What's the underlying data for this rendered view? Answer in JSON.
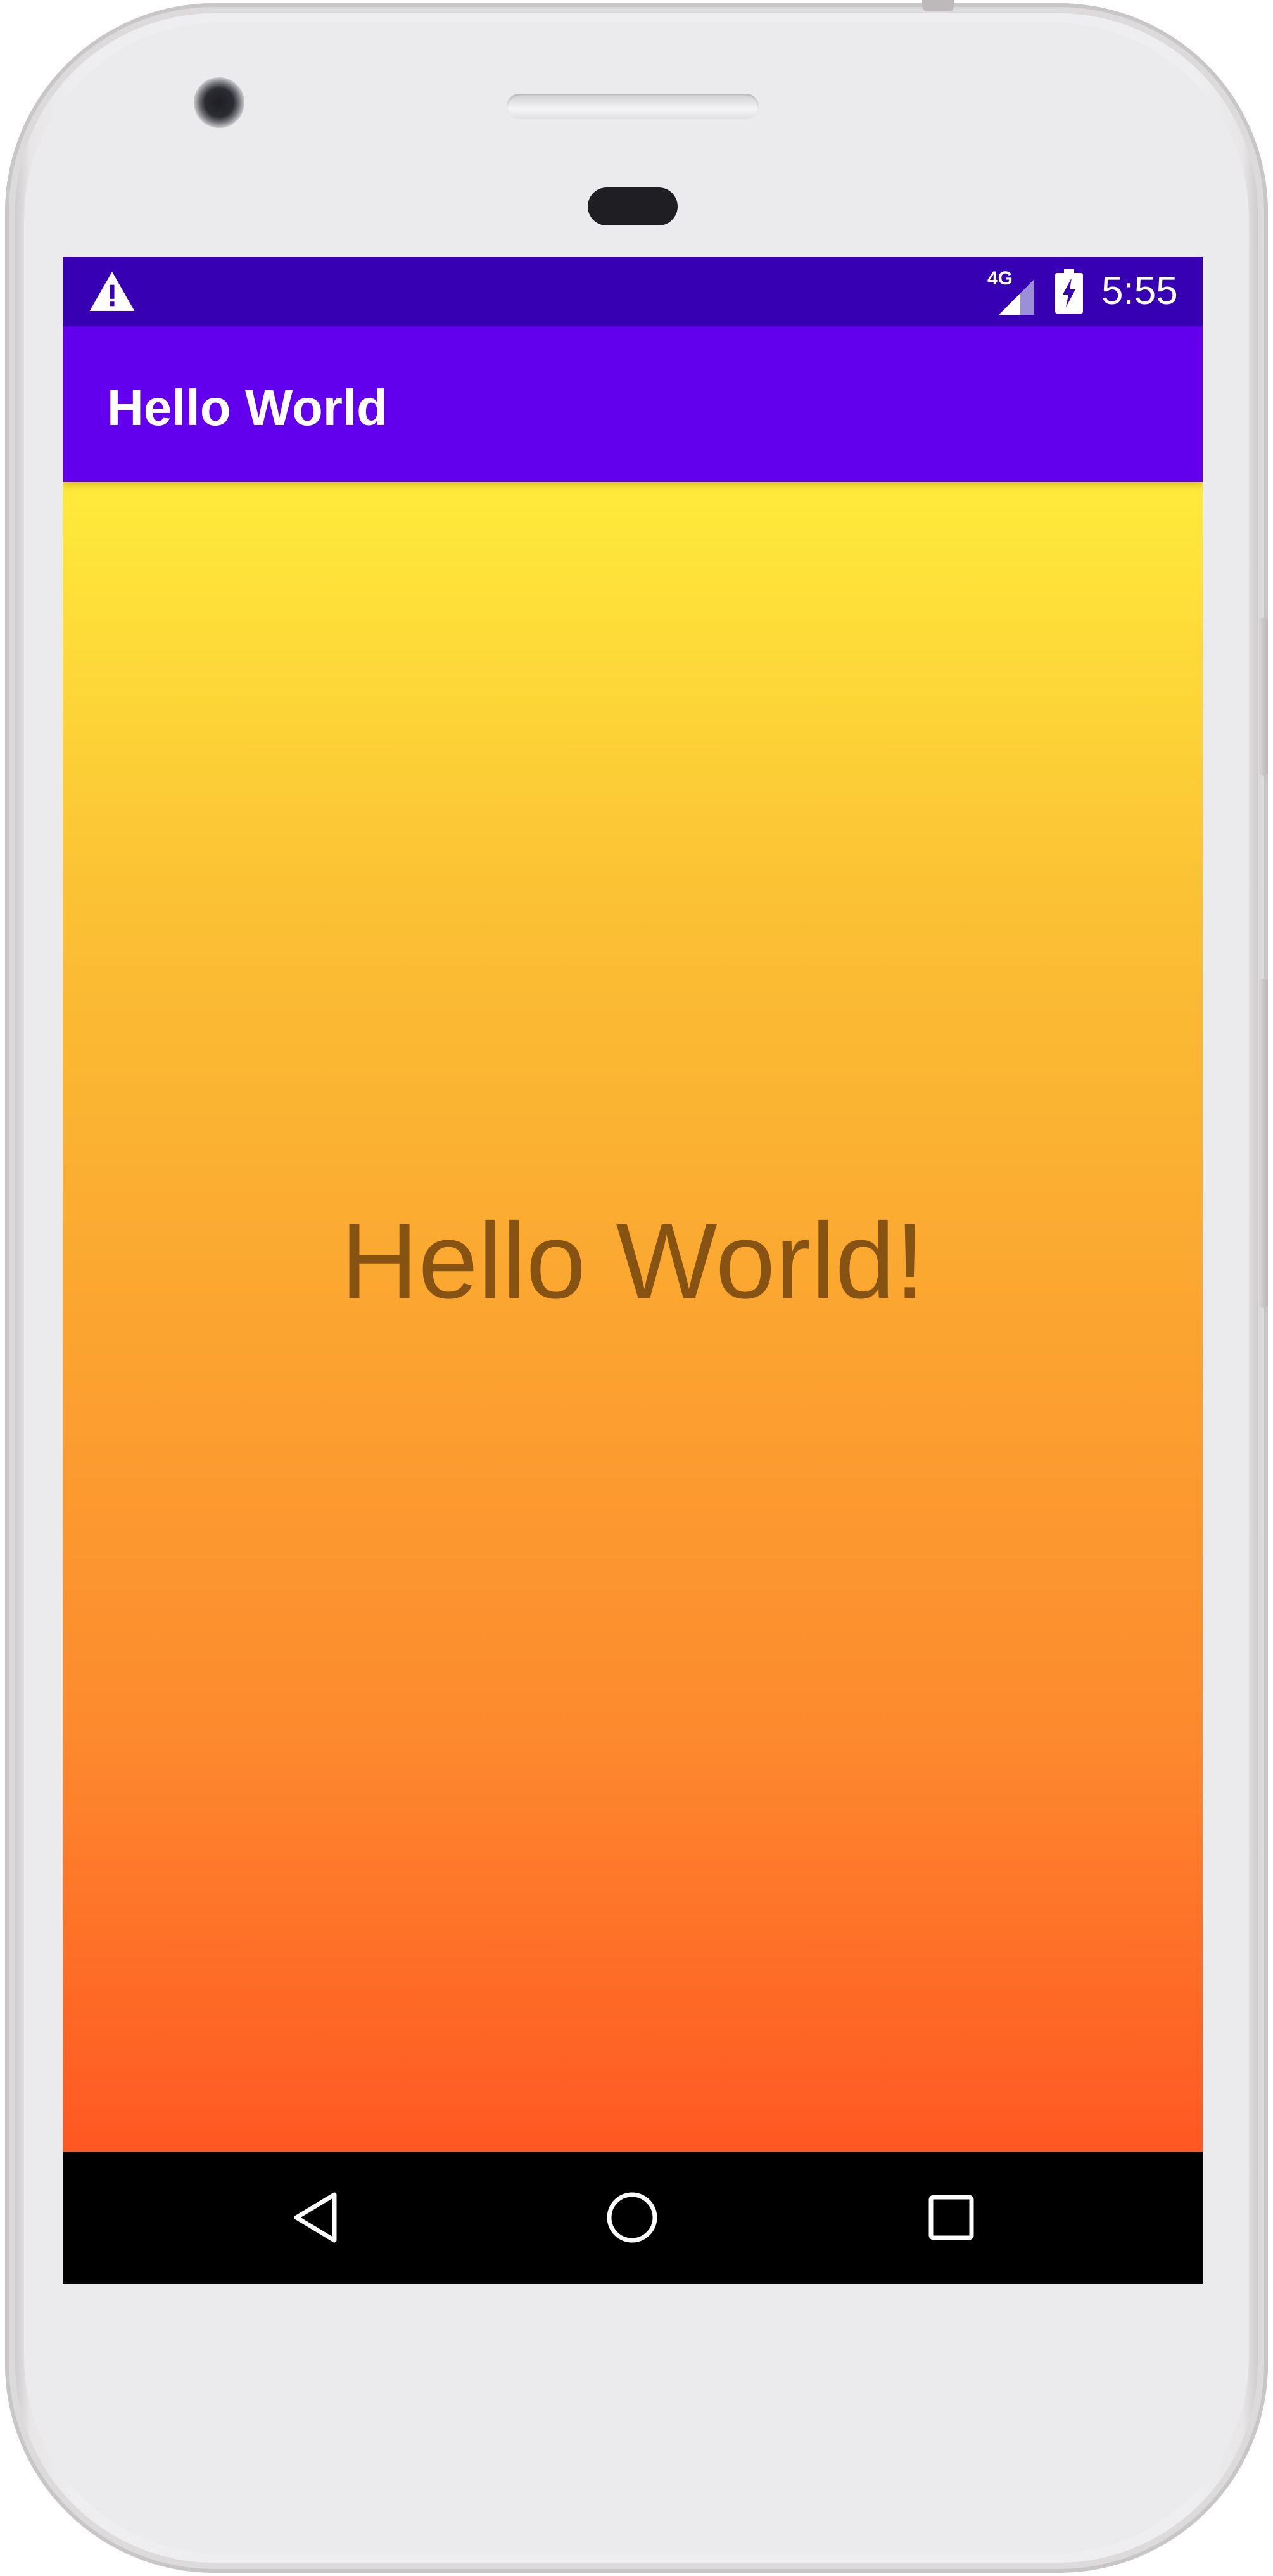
{
  "status_bar": {
    "time": "5:55",
    "network": "4G",
    "warning_icon": "warning-icon",
    "signal_icon": "signal-icon",
    "battery_icon": "battery-charging-icon"
  },
  "app_bar": {
    "title": "Hello World"
  },
  "content": {
    "message": "Hello World!"
  },
  "nav_bar": {
    "back_icon": "back-triangle-icon",
    "home_icon": "home-circle-icon",
    "recents_icon": "recents-square-icon"
  },
  "colors": {
    "status_bar": "#3700b3",
    "app_bar": "#6200ee",
    "gradient_top": "#ffeb3b",
    "gradient_bottom": "#ff5722",
    "nav_bar": "#000000",
    "text": "#7a4a10"
  }
}
